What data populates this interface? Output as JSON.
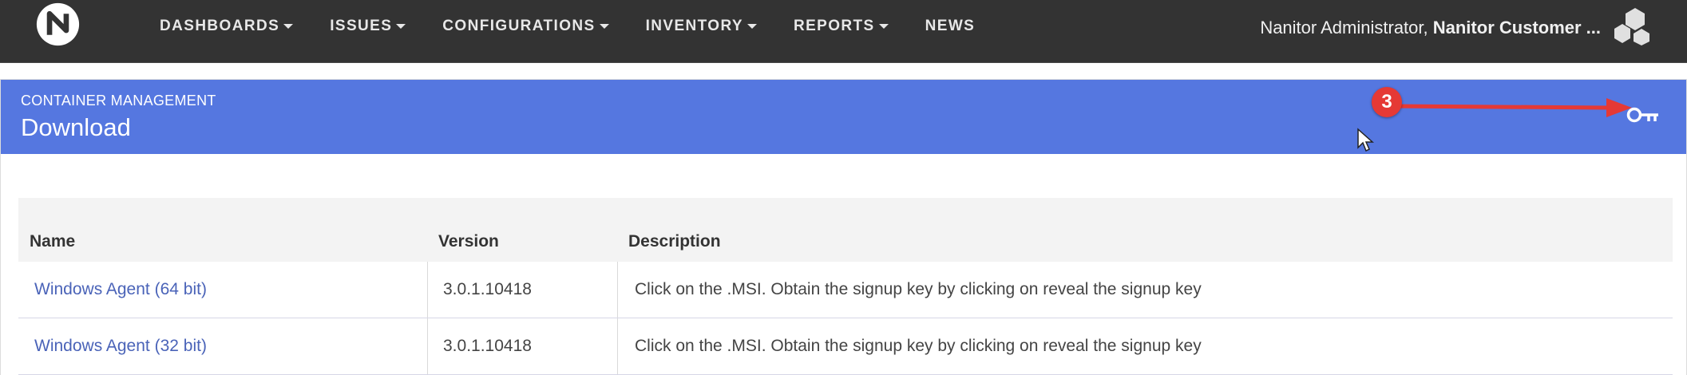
{
  "nav": {
    "items": [
      {
        "label": "DASHBOARDS",
        "dropdown": true
      },
      {
        "label": "ISSUES",
        "dropdown": true
      },
      {
        "label": "CONFIGURATIONS",
        "dropdown": true
      },
      {
        "label": "INVENTORY",
        "dropdown": true
      },
      {
        "label": "REPORTS",
        "dropdown": true
      },
      {
        "label": "NEWS",
        "dropdown": false
      }
    ],
    "user_name": "Nanitor Administrator,",
    "org_name": "Nanitor Customer ..."
  },
  "header": {
    "breadcrumb": "CONTAINER MANAGEMENT",
    "title": "Download",
    "annotation_number": "3",
    "key_icon": "key-icon",
    "color": "#5577e0"
  },
  "table": {
    "columns": [
      "Name",
      "Version",
      "Description"
    ],
    "rows": [
      {
        "name": "Windows Agent (64 bit)",
        "version": "3.0.1.10418",
        "description": "Click on the .MSI. Obtain the signup key by clicking on reveal the signup key"
      },
      {
        "name": "Windows Agent (32 bit)",
        "version": "3.0.1.10418",
        "description": "Click on the .MSI. Obtain the signup key by clicking on reveal the signup key"
      }
    ]
  },
  "colors": {
    "topbar": "#333333",
    "link": "#4a63b8",
    "annotation": "#e53935"
  }
}
